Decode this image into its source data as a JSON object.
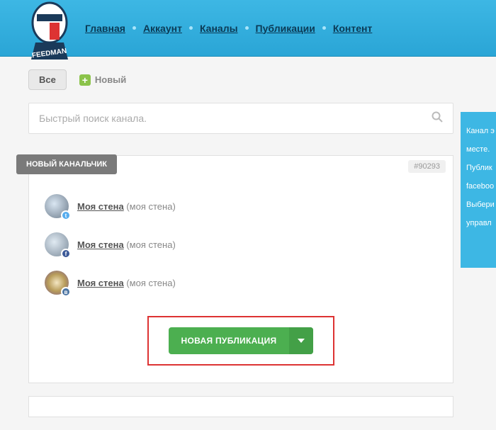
{
  "nav": {
    "items": [
      "Главная",
      "Аккаунт",
      "Каналы",
      "Публикации",
      "Контент"
    ]
  },
  "filters": {
    "all_label": "Все",
    "new_label": "Новый"
  },
  "search": {
    "placeholder": "Быстрый поиск канала."
  },
  "card": {
    "title": "НОВЫЙ КАНАЛЬЧИК",
    "id": "#90293",
    "channels": [
      {
        "name": "Моя стена",
        "suffix": "(моя стена)",
        "network": "t"
      },
      {
        "name": "Моя стена",
        "suffix": "(моя стена)",
        "network": "f"
      },
      {
        "name": "Моя стена",
        "suffix": "(моя стена)",
        "network": "в"
      }
    ],
    "new_pub_label": "НОВАЯ ПУБЛИКАЦИЯ"
  },
  "side": {
    "line1": "Канал э",
    "line2": "месте.",
    "line3": "Публик",
    "line4": "faceboo",
    "line5": "Выбери",
    "line6": "управл"
  }
}
